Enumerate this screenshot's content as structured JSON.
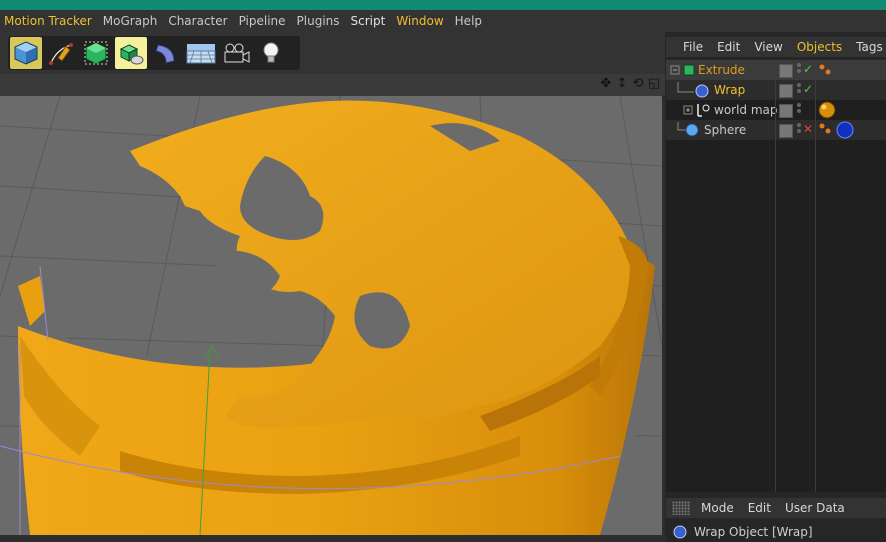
{
  "menubar": {
    "items": [
      {
        "label": "Motion Tracker",
        "style": "hl"
      },
      {
        "label": "MoGraph",
        "style": ""
      },
      {
        "label": "Character",
        "style": ""
      },
      {
        "label": "Pipeline",
        "style": ""
      },
      {
        "label": "Plugins",
        "style": ""
      },
      {
        "label": "Script",
        "style": "wh"
      },
      {
        "label": "Window",
        "style": "hl"
      },
      {
        "label": "Help",
        "style": ""
      }
    ]
  },
  "toolbar": {
    "tools": [
      {
        "name": "cube-primitive-icon",
        "state": "active"
      },
      {
        "name": "pen-spline-icon",
        "state": ""
      },
      {
        "name": "subdivision-surface-icon",
        "state": ""
      },
      {
        "name": "cloner-array-icon",
        "state": "sel"
      },
      {
        "name": "bend-deformer-icon",
        "state": ""
      },
      {
        "name": "floor-environment-icon",
        "state": ""
      },
      {
        "name": "camera-icon",
        "state": ""
      },
      {
        "name": "light-bulb-icon",
        "state": ""
      }
    ]
  },
  "objects_panel": {
    "menu": [
      {
        "label": "File",
        "style": ""
      },
      {
        "label": "Edit",
        "style": ""
      },
      {
        "label": "View",
        "style": ""
      },
      {
        "label": "Objects",
        "style": "hl"
      },
      {
        "label": "Tags",
        "style": ""
      }
    ],
    "rows": [
      {
        "name": "Extrude",
        "color": "#e09a20",
        "check": "✓",
        "check_color": "#4ec94e"
      },
      {
        "name": "Wrap",
        "color": "#f0c030",
        "check": "✓",
        "check_color": "#4ec94e"
      },
      {
        "name": "world map",
        "color": "#c8c8c8",
        "check": "",
        "check_color": ""
      },
      {
        "name": "Sphere",
        "color": "#c8c8c8",
        "check": "✕",
        "check_color": "#e04040"
      }
    ]
  },
  "attributes_panel": {
    "menu": [
      {
        "label": "Mode"
      },
      {
        "label": "Edit"
      },
      {
        "label": "User Data"
      }
    ],
    "title": "Wrap Object [Wrap]"
  },
  "colors": {
    "accent": "#f0c030",
    "object_orange": "#e8a010",
    "titlebar": "#118a74"
  }
}
